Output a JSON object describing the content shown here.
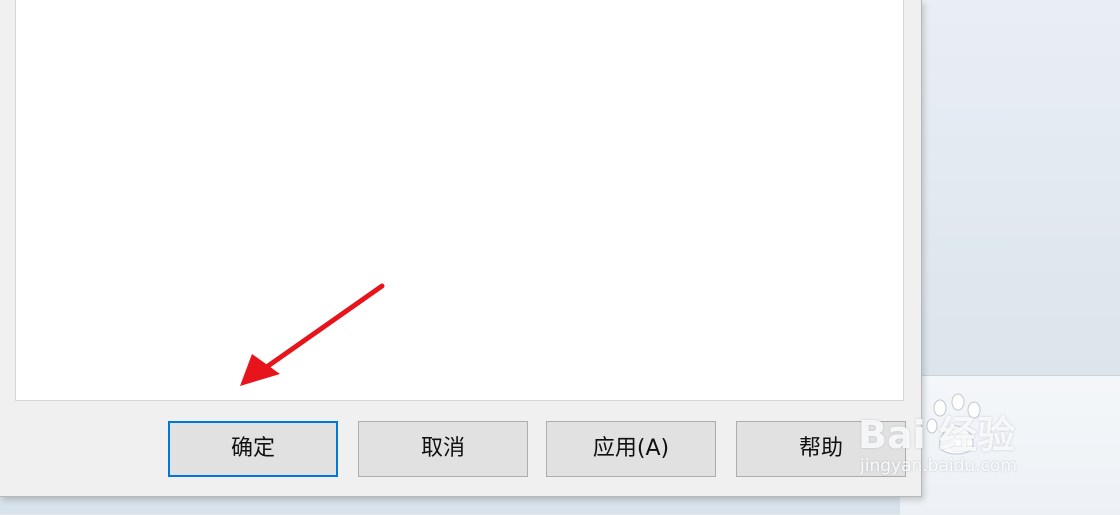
{
  "dialog": {
    "buttons": {
      "ok": "确定",
      "cancel": "取消",
      "apply": "应用(A)",
      "help": "帮助"
    }
  },
  "annotation": {
    "arrow_color": "#e8141b",
    "icon": "red-arrow-icon"
  },
  "watermark": {
    "logo": "Bai 经验",
    "url": "jingyan.baidu.com",
    "icon": "baidu-paw-icon"
  },
  "colors": {
    "accent": "#0078d7",
    "button_bg": "#e1e1e1",
    "dialog_bg": "#f0f0f0"
  }
}
